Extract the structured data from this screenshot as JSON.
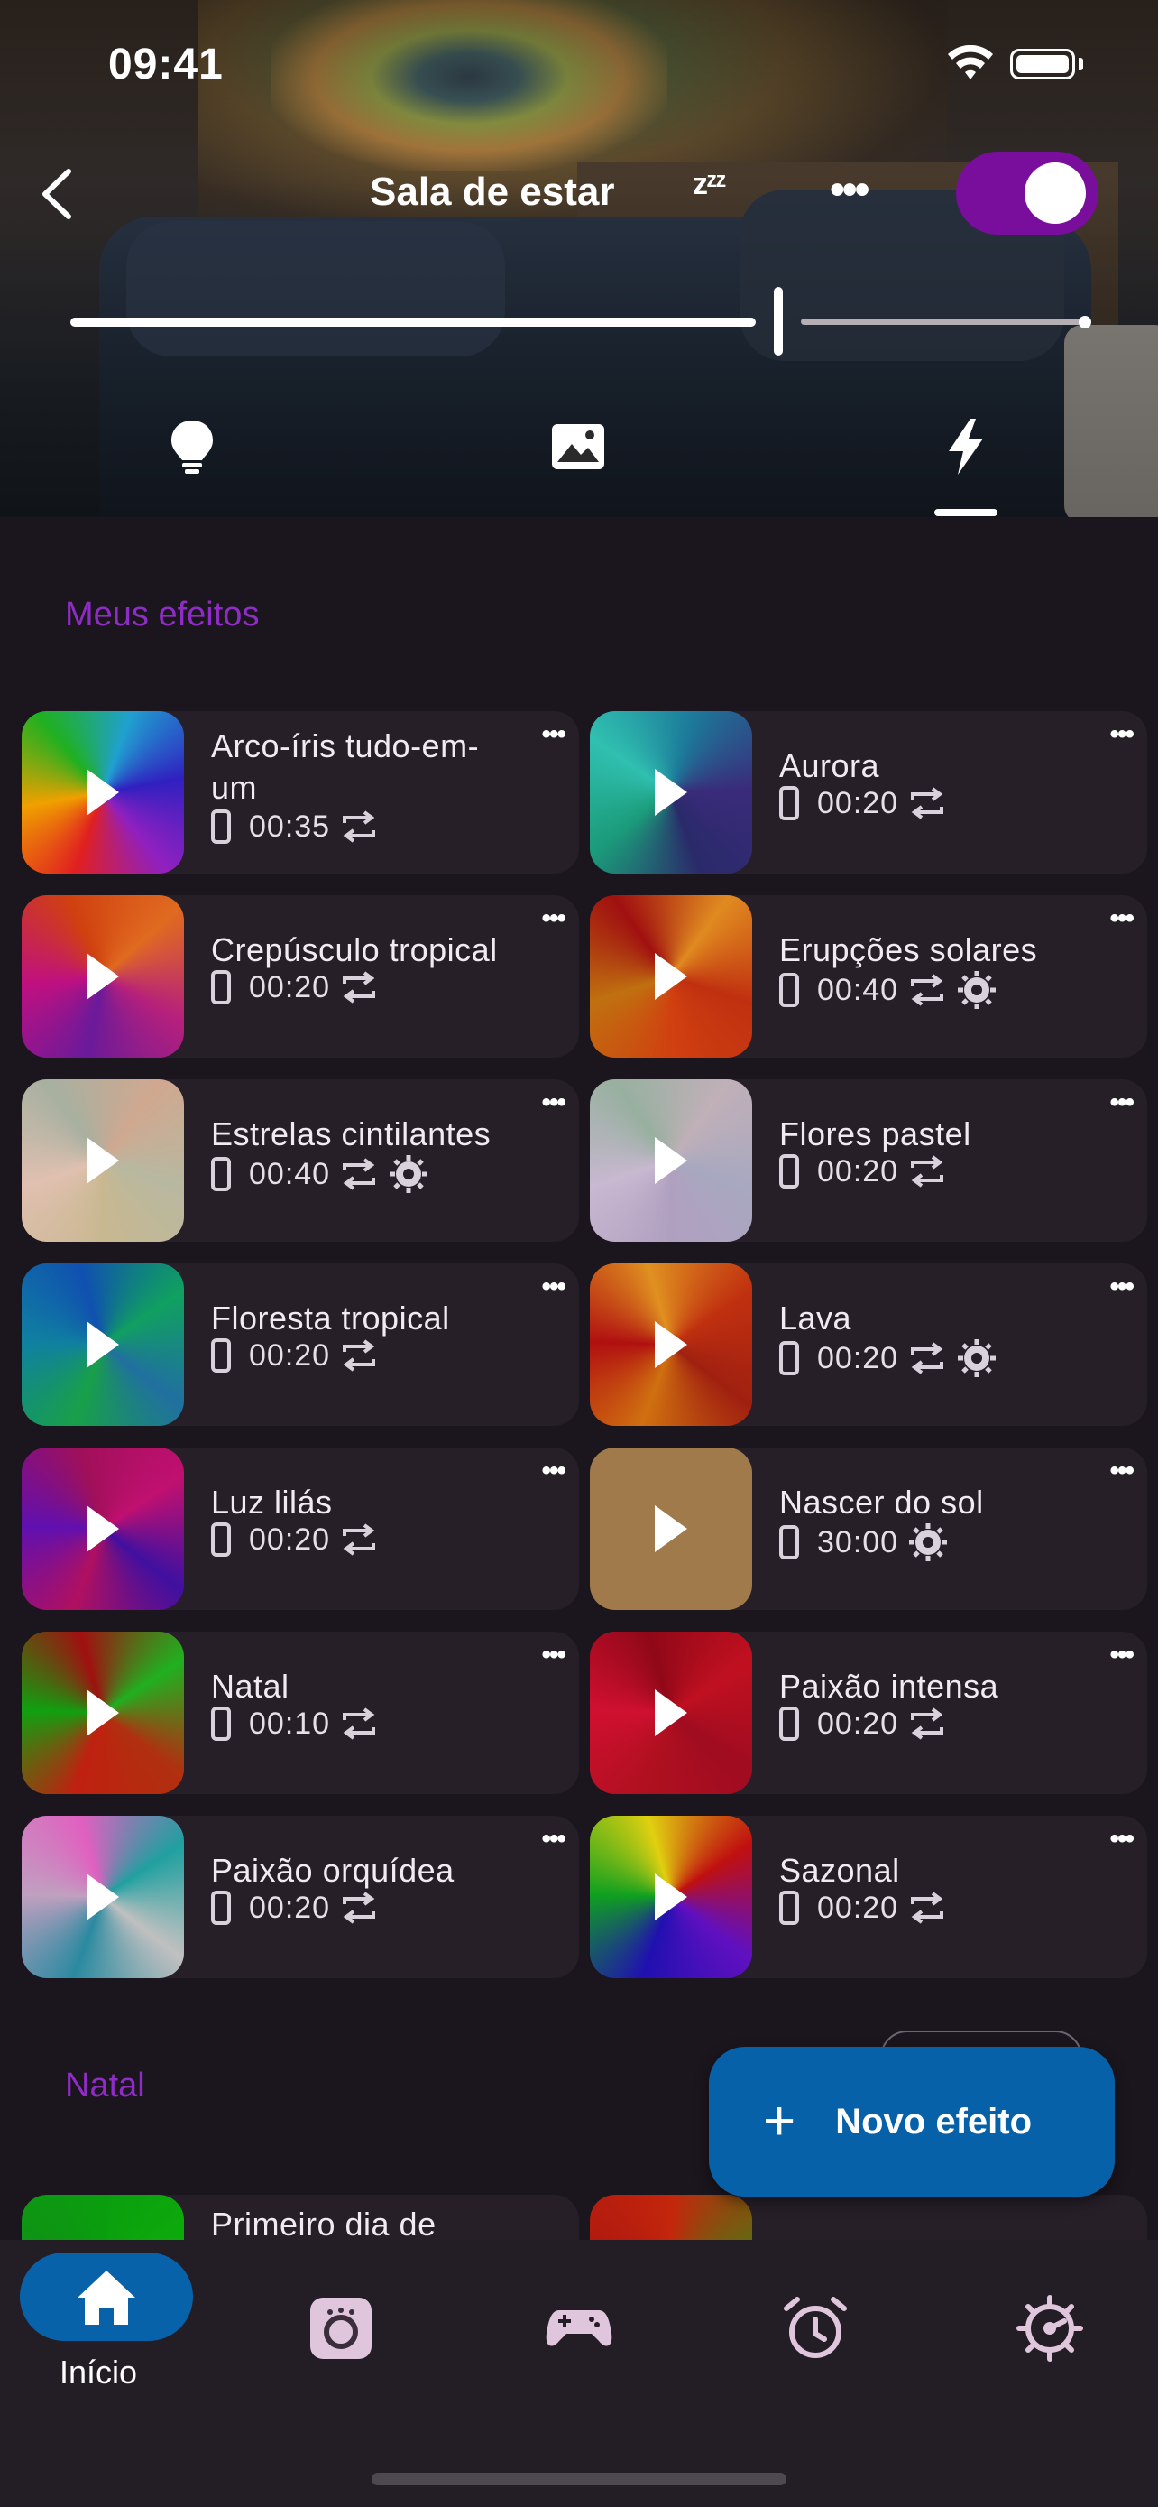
{
  "status_bar": {
    "time": "09:41"
  },
  "header": {
    "title": "Sala de estar",
    "sleep_icon_text": "zᶻᶻ",
    "more_text": "•••"
  },
  "sections": [
    {
      "title": "Meus efeitos",
      "effects": [
        {
          "name": "Arco-íris tudo-em-um",
          "duration": "00:35",
          "repeat": true,
          "brightness": false
        },
        {
          "name": "Aurora",
          "duration": "00:20",
          "repeat": true,
          "brightness": false
        },
        {
          "name": "Crepúsculo tropical",
          "duration": "00:20",
          "repeat": true,
          "brightness": false
        },
        {
          "name": "Erupções solares",
          "duration": "00:40",
          "repeat": true,
          "brightness": true
        },
        {
          "name": "Estrelas cintilantes",
          "duration": "00:40",
          "repeat": true,
          "brightness": true
        },
        {
          "name": "Flores pastel",
          "duration": "00:20",
          "repeat": true,
          "brightness": false
        },
        {
          "name": "Floresta tropical",
          "duration": "00:20",
          "repeat": true,
          "brightness": false
        },
        {
          "name": "Lava",
          "duration": "00:20",
          "repeat": true,
          "brightness": true
        },
        {
          "name": "Luz lilás",
          "duration": "00:20",
          "repeat": true,
          "brightness": false
        },
        {
          "name": "Nascer do sol",
          "duration": "30:00",
          "repeat": false,
          "brightness": true
        },
        {
          "name": "Natal",
          "duration": "00:10",
          "repeat": true,
          "brightness": false
        },
        {
          "name": "Paixão intensa",
          "duration": "00:20",
          "repeat": true,
          "brightness": false
        },
        {
          "name": "Paixão orquídea",
          "duration": "00:20",
          "repeat": true,
          "brightness": false
        },
        {
          "name": "Sazonal",
          "duration": "00:20",
          "repeat": true,
          "brightness": false
        }
      ]
    },
    {
      "title": "Natal",
      "effects": [
        {
          "name": "Primeiro dia de"
        }
      ]
    }
  ],
  "fab": {
    "plus": "+",
    "label": "Novo efeito"
  },
  "bottom_nav": {
    "home_label": "Início"
  },
  "colors": {
    "accent_purple": "#8f2cc7",
    "toggle": "#7a0e9c",
    "primary_blue": "#0761a8",
    "background": "#1b161d",
    "card": "#261f28"
  }
}
